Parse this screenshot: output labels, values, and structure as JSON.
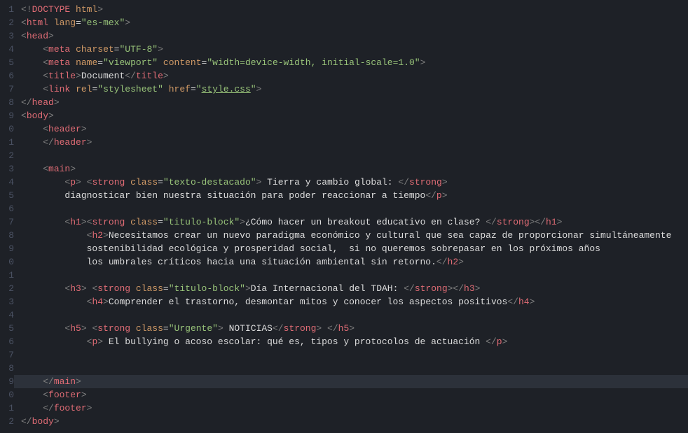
{
  "lines": [
    {
      "n": 1,
      "indent": 0,
      "parts": [
        {
          "t": "<!",
          "c": "c-bracket"
        },
        {
          "t": "DOCTYPE",
          "c": "c-tag"
        },
        {
          "t": " ",
          "c": "c-text"
        },
        {
          "t": "html",
          "c": "c-attr"
        },
        {
          "t": ">",
          "c": "c-bracket"
        }
      ]
    },
    {
      "n": 2,
      "indent": 0,
      "parts": [
        {
          "t": "<",
          "c": "c-bracket"
        },
        {
          "t": "html",
          "c": "c-tag"
        },
        {
          "t": " ",
          "c": "c-text"
        },
        {
          "t": "lang",
          "c": "c-attr"
        },
        {
          "t": "=",
          "c": "c-white"
        },
        {
          "t": "\"es-mex\"",
          "c": "c-string"
        },
        {
          "t": ">",
          "c": "c-bracket"
        }
      ]
    },
    {
      "n": 3,
      "indent": 0,
      "parts": [
        {
          "t": "<",
          "c": "c-bracket"
        },
        {
          "t": "head",
          "c": "c-tag"
        },
        {
          "t": ">",
          "c": "c-bracket"
        }
      ]
    },
    {
      "n": 4,
      "indent": 1,
      "parts": [
        {
          "t": "<",
          "c": "c-bracket"
        },
        {
          "t": "meta",
          "c": "c-tag"
        },
        {
          "t": " ",
          "c": "c-text"
        },
        {
          "t": "charset",
          "c": "c-attr"
        },
        {
          "t": "=",
          "c": "c-white"
        },
        {
          "t": "\"UTF-8\"",
          "c": "c-string"
        },
        {
          "t": ">",
          "c": "c-bracket"
        }
      ]
    },
    {
      "n": 5,
      "indent": 1,
      "parts": [
        {
          "t": "<",
          "c": "c-bracket"
        },
        {
          "t": "meta",
          "c": "c-tag"
        },
        {
          "t": " ",
          "c": "c-text"
        },
        {
          "t": "name",
          "c": "c-attr"
        },
        {
          "t": "=",
          "c": "c-white"
        },
        {
          "t": "\"viewport\"",
          "c": "c-string"
        },
        {
          "t": " ",
          "c": "c-text"
        },
        {
          "t": "content",
          "c": "c-attr"
        },
        {
          "t": "=",
          "c": "c-white"
        },
        {
          "t": "\"width=device-width, initial-scale=1.0\"",
          "c": "c-string"
        },
        {
          "t": ">",
          "c": "c-bracket"
        }
      ]
    },
    {
      "n": 6,
      "indent": 1,
      "parts": [
        {
          "t": "<",
          "c": "c-bracket"
        },
        {
          "t": "title",
          "c": "c-tag"
        },
        {
          "t": ">",
          "c": "c-bracket"
        },
        {
          "t": "Document",
          "c": "c-white"
        },
        {
          "t": "</",
          "c": "c-bracket"
        },
        {
          "t": "title",
          "c": "c-tag"
        },
        {
          "t": ">",
          "c": "c-bracket"
        }
      ]
    },
    {
      "n": 7,
      "indent": 1,
      "parts": [
        {
          "t": "<",
          "c": "c-bracket"
        },
        {
          "t": "link",
          "c": "c-tag"
        },
        {
          "t": " ",
          "c": "c-text"
        },
        {
          "t": "rel",
          "c": "c-attr"
        },
        {
          "t": "=",
          "c": "c-white"
        },
        {
          "t": "\"stylesheet\"",
          "c": "c-string"
        },
        {
          "t": " ",
          "c": "c-text"
        },
        {
          "t": "href",
          "c": "c-attr"
        },
        {
          "t": "=",
          "c": "c-white"
        },
        {
          "t": "\"",
          "c": "c-string"
        },
        {
          "t": "style.css",
          "c": "c-string underline"
        },
        {
          "t": "\"",
          "c": "c-string"
        },
        {
          "t": ">",
          "c": "c-bracket"
        }
      ]
    },
    {
      "n": 8,
      "indent": 0,
      "parts": [
        {
          "t": "</",
          "c": "c-bracket"
        },
        {
          "t": "head",
          "c": "c-tag"
        },
        {
          "t": ">",
          "c": "c-bracket"
        }
      ]
    },
    {
      "n": 9,
      "indent": 0,
      "parts": [
        {
          "t": "<",
          "c": "c-bracket"
        },
        {
          "t": "body",
          "c": "c-tag"
        },
        {
          "t": ">",
          "c": "c-bracket"
        }
      ]
    },
    {
      "n": 0,
      "indent": 1,
      "parts": [
        {
          "t": "<",
          "c": "c-bracket"
        },
        {
          "t": "header",
          "c": "c-tag"
        },
        {
          "t": ">",
          "c": "c-bracket"
        }
      ]
    },
    {
      "n": 1,
      "indent": 1,
      "parts": [
        {
          "t": "</",
          "c": "c-bracket"
        },
        {
          "t": "header",
          "c": "c-tag"
        },
        {
          "t": ">",
          "c": "c-bracket"
        }
      ]
    },
    {
      "n": 2,
      "indent": 0,
      "parts": []
    },
    {
      "n": 3,
      "indent": 1,
      "parts": [
        {
          "t": "<",
          "c": "c-bracket"
        },
        {
          "t": "main",
          "c": "c-tag"
        },
        {
          "t": ">",
          "c": "c-bracket"
        }
      ]
    },
    {
      "n": 4,
      "indent": 2,
      "parts": [
        {
          "t": "<",
          "c": "c-bracket"
        },
        {
          "t": "p",
          "c": "c-tag"
        },
        {
          "t": ">",
          "c": "c-bracket"
        },
        {
          "t": " ",
          "c": "c-text"
        },
        {
          "t": "<",
          "c": "c-bracket"
        },
        {
          "t": "strong",
          "c": "c-tag"
        },
        {
          "t": " ",
          "c": "c-text"
        },
        {
          "t": "class",
          "c": "c-attr"
        },
        {
          "t": "=",
          "c": "c-white"
        },
        {
          "t": "\"texto-destacado\"",
          "c": "c-string"
        },
        {
          "t": ">",
          "c": "c-bracket"
        },
        {
          "t": " Tierra y cambio global: ",
          "c": "c-white"
        },
        {
          "t": "</",
          "c": "c-bracket"
        },
        {
          "t": "strong",
          "c": "c-tag"
        },
        {
          "t": ">",
          "c": "c-bracket"
        }
      ]
    },
    {
      "n": 5,
      "indent": 2,
      "parts": [
        {
          "t": "diagnosticar bien nuestra situación para poder reaccionar a tiempo",
          "c": "c-white"
        },
        {
          "t": "</",
          "c": "c-bracket"
        },
        {
          "t": "p",
          "c": "c-tag"
        },
        {
          "t": ">",
          "c": "c-bracket"
        }
      ]
    },
    {
      "n": 6,
      "indent": 0,
      "parts": []
    },
    {
      "n": 7,
      "indent": 2,
      "parts": [
        {
          "t": "<",
          "c": "c-bracket"
        },
        {
          "t": "h1",
          "c": "c-tag"
        },
        {
          "t": "><",
          "c": "c-bracket"
        },
        {
          "t": "strong",
          "c": "c-tag"
        },
        {
          "t": " ",
          "c": "c-text"
        },
        {
          "t": "class",
          "c": "c-attr"
        },
        {
          "t": "=",
          "c": "c-white"
        },
        {
          "t": "\"titulo-block\"",
          "c": "c-string"
        },
        {
          "t": ">",
          "c": "c-bracket"
        },
        {
          "t": "¿Cómo hacer un breakout educativo en clase? ",
          "c": "c-white"
        },
        {
          "t": "</",
          "c": "c-bracket"
        },
        {
          "t": "strong",
          "c": "c-tag"
        },
        {
          "t": "></",
          "c": "c-bracket"
        },
        {
          "t": "h1",
          "c": "c-tag"
        },
        {
          "t": ">",
          "c": "c-bracket"
        }
      ]
    },
    {
      "n": 8,
      "indent": 3,
      "parts": [
        {
          "t": "<",
          "c": "c-bracket"
        },
        {
          "t": "h2",
          "c": "c-tag"
        },
        {
          "t": ">",
          "c": "c-bracket"
        },
        {
          "t": "Necesitamos crear un nuevo paradigma económico y cultural que sea capaz de proporcionar simultáneamente ",
          "c": "c-white"
        }
      ]
    },
    {
      "n": 9,
      "indent": 3,
      "parts": [
        {
          "t": "sostenibilidad ecológica y prosperidad social,  si no queremos sobrepasar en los próximos años ",
          "c": "c-white"
        }
      ]
    },
    {
      "n": 0,
      "indent": 3,
      "parts": [
        {
          "t": "los umbrales críticos hacia una situación ambiental sin retorno.",
          "c": "c-white"
        },
        {
          "t": "</",
          "c": "c-bracket"
        },
        {
          "t": "h2",
          "c": "c-tag"
        },
        {
          "t": ">",
          "c": "c-bracket"
        }
      ]
    },
    {
      "n": 1,
      "indent": 0,
      "parts": []
    },
    {
      "n": 2,
      "indent": 2,
      "parts": [
        {
          "t": "<",
          "c": "c-bracket"
        },
        {
          "t": "h3",
          "c": "c-tag"
        },
        {
          "t": ">",
          "c": "c-bracket"
        },
        {
          "t": " ",
          "c": "c-text"
        },
        {
          "t": "<",
          "c": "c-bracket"
        },
        {
          "t": "strong",
          "c": "c-tag"
        },
        {
          "t": " ",
          "c": "c-text"
        },
        {
          "t": "class",
          "c": "c-attr"
        },
        {
          "t": "=",
          "c": "c-white"
        },
        {
          "t": "\"titulo-block\"",
          "c": "c-string"
        },
        {
          "t": ">",
          "c": "c-bracket"
        },
        {
          "t": "Día Internacional del TDAH: ",
          "c": "c-white"
        },
        {
          "t": "</",
          "c": "c-bracket"
        },
        {
          "t": "strong",
          "c": "c-tag"
        },
        {
          "t": "></",
          "c": "c-bracket"
        },
        {
          "t": "h3",
          "c": "c-tag"
        },
        {
          "t": ">",
          "c": "c-bracket"
        }
      ]
    },
    {
      "n": 3,
      "indent": 3,
      "parts": [
        {
          "t": "<",
          "c": "c-bracket"
        },
        {
          "t": "h4",
          "c": "c-tag"
        },
        {
          "t": ">",
          "c": "c-bracket"
        },
        {
          "t": "Comprender el trastorno, desmontar mitos y conocer los aspectos positivos",
          "c": "c-white"
        },
        {
          "t": "</",
          "c": "c-bracket"
        },
        {
          "t": "h4",
          "c": "c-tag"
        },
        {
          "t": ">",
          "c": "c-bracket"
        }
      ]
    },
    {
      "n": 4,
      "indent": 0,
      "parts": []
    },
    {
      "n": 5,
      "indent": 2,
      "parts": [
        {
          "t": "<",
          "c": "c-bracket"
        },
        {
          "t": "h5",
          "c": "c-tag"
        },
        {
          "t": ">",
          "c": "c-bracket"
        },
        {
          "t": " ",
          "c": "c-text"
        },
        {
          "t": "<",
          "c": "c-bracket"
        },
        {
          "t": "strong",
          "c": "c-tag"
        },
        {
          "t": " ",
          "c": "c-text"
        },
        {
          "t": "class",
          "c": "c-attr"
        },
        {
          "t": "=",
          "c": "c-white"
        },
        {
          "t": "\"Urgente\"",
          "c": "c-string"
        },
        {
          "t": ">",
          "c": "c-bracket"
        },
        {
          "t": " NOTICIAS",
          "c": "c-white"
        },
        {
          "t": "</",
          "c": "c-bracket"
        },
        {
          "t": "strong",
          "c": "c-tag"
        },
        {
          "t": ">",
          "c": "c-bracket"
        },
        {
          "t": " ",
          "c": "c-text"
        },
        {
          "t": "</",
          "c": "c-bracket"
        },
        {
          "t": "h5",
          "c": "c-tag"
        },
        {
          "t": ">",
          "c": "c-bracket"
        }
      ]
    },
    {
      "n": 6,
      "indent": 3,
      "parts": [
        {
          "t": "<",
          "c": "c-bracket"
        },
        {
          "t": "p",
          "c": "c-tag"
        },
        {
          "t": ">",
          "c": "c-bracket"
        },
        {
          "t": " El bullying o acoso escolar: qué es, tipos y protocolos de actuación ",
          "c": "c-white"
        },
        {
          "t": "</",
          "c": "c-bracket"
        },
        {
          "t": "p",
          "c": "c-tag"
        },
        {
          "t": ">",
          "c": "c-bracket"
        }
      ]
    },
    {
      "n": 7,
      "indent": 0,
      "parts": []
    },
    {
      "n": 8,
      "indent": 0,
      "parts": []
    },
    {
      "n": 9,
      "indent": 1,
      "highlight": true,
      "parts": [
        {
          "t": "</",
          "c": "c-bracket"
        },
        {
          "t": "main",
          "c": "c-tag"
        },
        {
          "t": ">",
          "c": "c-bracket"
        }
      ]
    },
    {
      "n": 0,
      "indent": 1,
      "parts": [
        {
          "t": "<",
          "c": "c-bracket"
        },
        {
          "t": "footer",
          "c": "c-tag"
        },
        {
          "t": ">",
          "c": "c-bracket"
        }
      ]
    },
    {
      "n": 1,
      "indent": 1,
      "parts": [
        {
          "t": "</",
          "c": "c-bracket"
        },
        {
          "t": "footer",
          "c": "c-tag"
        },
        {
          "t": ">",
          "c": "c-bracket"
        }
      ]
    },
    {
      "n": 2,
      "indent": 0,
      "parts": [
        {
          "t": "</",
          "c": "c-bracket"
        },
        {
          "t": "body",
          "c": "c-tag"
        },
        {
          "t": ">",
          "c": "c-bracket"
        }
      ]
    }
  ]
}
